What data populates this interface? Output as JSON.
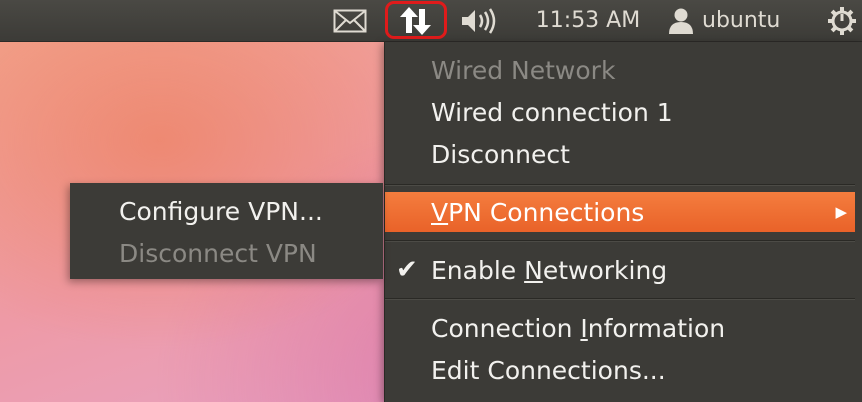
{
  "panel": {
    "clock": "11:53 AM",
    "user_name": "ubuntu",
    "icons": {
      "mail": "envelope-icon",
      "network": "network-updown-icon",
      "volume": "speaker-icon",
      "user": "person-icon",
      "power": "gear-power-icon"
    },
    "highlight_color": "#e01b1b"
  },
  "network_menu": {
    "header": "Wired Network",
    "items": [
      {
        "label": "Wired connection 1"
      },
      {
        "label": "Disconnect"
      },
      {
        "label": "VPN Connections",
        "mnemonic": "V",
        "rest": "PN Connections",
        "has_submenu": true,
        "highlighted": true
      },
      {
        "label": "Enable Networking",
        "pre": "Enable ",
        "mnemonic": "N",
        "rest": "etworking",
        "checked": true
      },
      {
        "label": "Connection Information",
        "pre": "Connection ",
        "mnemonic": "I",
        "rest": "nformation"
      },
      {
        "label": "Edit Connections..."
      }
    ],
    "highlight_color": "#f07236"
  },
  "vpn_submenu": {
    "items": [
      {
        "label": "Configure VPN..."
      },
      {
        "label": "Disconnect VPN",
        "disabled": true
      }
    ]
  }
}
